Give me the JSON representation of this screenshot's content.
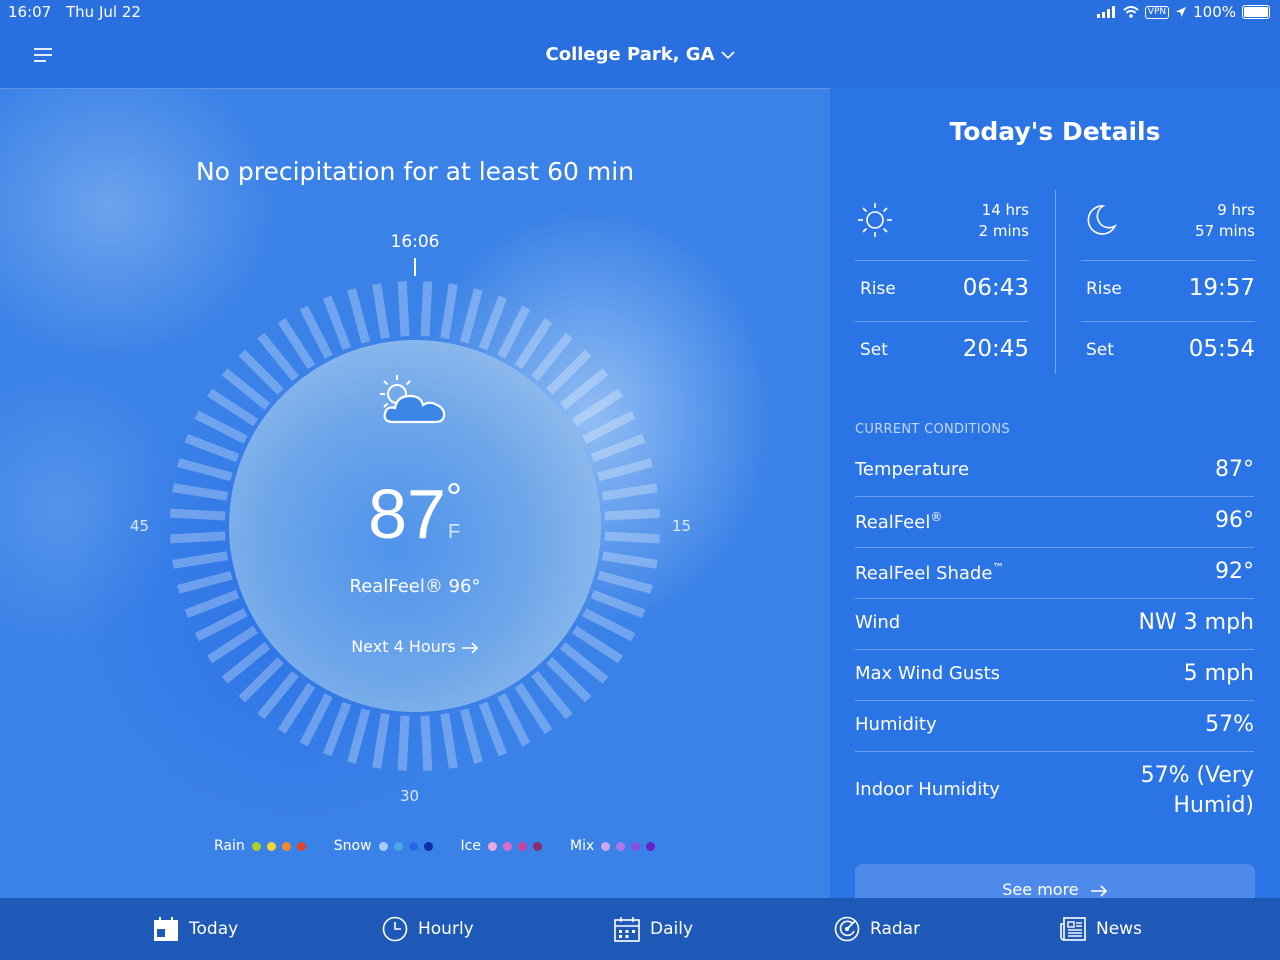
{
  "status_bar": {
    "time": "16:07",
    "date": "Thu Jul 22",
    "vpn": "VPN",
    "battery": "100%"
  },
  "header": {
    "location": "College Park, GA"
  },
  "minutecast": {
    "title": "No precipitation for at least 60 min",
    "current_time": "16:06",
    "dial_marks": {
      "left": "45",
      "right": "15",
      "bottom": "30"
    }
  },
  "current": {
    "temp": "87",
    "deg": "°",
    "unit": "F",
    "realfeel_label": "RealFeel® 96°",
    "next_hours": "Next 4 Hours"
  },
  "legend": [
    {
      "label": "Rain",
      "colors": [
        "#a9d22f",
        "#f2d338",
        "#f08a2f",
        "#e0452c"
      ]
    },
    {
      "label": "Snow",
      "colors": [
        "#a9c9f2",
        "#4aa7ea",
        "#2666e6",
        "#0d2fa8"
      ]
    },
    {
      "label": "Ice",
      "colors": [
        "#e8a8dc",
        "#d96fc6",
        "#c2459e",
        "#8f2a6a"
      ]
    },
    {
      "label": "Mix",
      "colors": [
        "#c9a8ee",
        "#ad78e8",
        "#8a4de0",
        "#5f22c4"
      ]
    }
  ],
  "details": {
    "title": "Today's Details",
    "sun": {
      "duration_line1": "14 hrs",
      "duration_line2": "2 mins",
      "rise_label": "Rise",
      "rise": "06:43",
      "set_label": "Set",
      "set": "20:45"
    },
    "moon": {
      "duration_line1": "9 hrs",
      "duration_line2": "57 mins",
      "rise_label": "Rise",
      "rise": "19:57",
      "set_label": "Set",
      "set": "05:54"
    },
    "conditions_label": "CURRENT CONDITIONS",
    "conditions": {
      "temperature": {
        "label": "Temperature",
        "value": "87°"
      },
      "realfeel": {
        "label": "RealFeel",
        "mark": "®",
        "value": "96°"
      },
      "realfeel_shade": {
        "label": "RealFeel Shade",
        "mark": "™",
        "value": "92°"
      },
      "wind": {
        "label": "Wind",
        "value": "NW 3 mph"
      },
      "gusts": {
        "label": "Max Wind Gusts",
        "value": "5 mph"
      },
      "humidity": {
        "label": "Humidity",
        "value": "57%"
      },
      "indoor_humidity": {
        "label": "Indoor Humidity",
        "value_line1": "57% (Very",
        "value_line2": "Humid)"
      }
    },
    "see_more": "See more"
  },
  "tabs": {
    "today": "Today",
    "hourly": "Hourly",
    "daily": "Daily",
    "radar": "Radar",
    "news": "News"
  },
  "colors": {
    "background": "#2a6fe0",
    "panel": "#2b74e6",
    "tab_bar": "#1f59b8"
  }
}
